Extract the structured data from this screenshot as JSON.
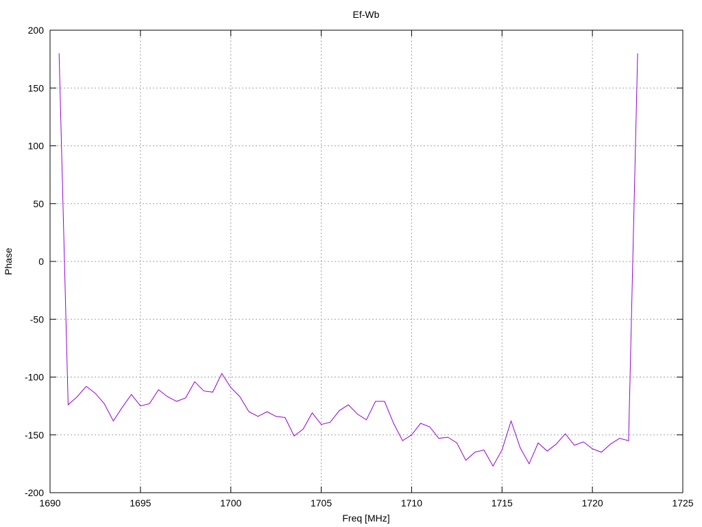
{
  "chart_data": {
    "type": "line",
    "title": "Ef-Wb",
    "xlabel": "Freq [MHz]",
    "ylabel": "Phase",
    "xlim": [
      1690,
      1725
    ],
    "ylim": [
      -200,
      200
    ],
    "xticks": [
      1690,
      1695,
      1700,
      1705,
      1710,
      1715,
      1720,
      1725
    ],
    "yticks": [
      -200,
      -150,
      -100,
      -50,
      0,
      50,
      100,
      150,
      200
    ],
    "grid": true,
    "line_color": "#9400d3",
    "series": [
      {
        "x": [
          1690.5,
          1691.0,
          1691.5,
          1692.0,
          1692.5,
          1693.0,
          1693.5,
          1694.0,
          1694.5,
          1695.0,
          1695.5,
          1696.0,
          1696.5,
          1697.0,
          1697.5,
          1698.0,
          1698.5,
          1699.0,
          1699.5,
          1700.0,
          1700.5,
          1701.0,
          1701.5,
          1702.0,
          1702.5,
          1703.0,
          1703.5,
          1704.0,
          1704.5,
          1705.0,
          1705.5,
          1706.0,
          1706.5,
          1707.0,
          1707.5,
          1708.0,
          1708.5,
          1709.0,
          1709.5,
          1710.0,
          1710.5,
          1711.0,
          1711.5,
          1712.0,
          1712.5,
          1713.0,
          1713.5,
          1714.0,
          1714.5,
          1715.0,
          1715.5,
          1716.0,
          1716.5,
          1717.0,
          1717.5,
          1718.0,
          1718.5,
          1719.0,
          1719.5,
          1720.0,
          1720.5,
          1721.0,
          1721.5,
          1722.0,
          1722.5
        ],
        "y": [
          180,
          -124,
          -117,
          -108,
          -114,
          -123,
          -138,
          -126,
          -115,
          -125,
          -123,
          -111,
          -117,
          -121,
          -118,
          -104,
          -112,
          -113,
          -97,
          -109,
          -117,
          -130,
          -134,
          -130,
          -134,
          -135,
          -151,
          -145,
          -131,
          -141,
          -139,
          -129,
          -124,
          -132,
          -137,
          -121,
          -121,
          -140,
          -155,
          -150,
          -140,
          -143,
          -153,
          -152,
          -157,
          -172,
          -165,
          -163,
          -177,
          -163,
          -138,
          -161,
          -175,
          -157,
          -164,
          -158,
          -149,
          -159,
          -156,
          -162,
          -165,
          -158,
          -153,
          -155,
          180
        ]
      }
    ]
  }
}
